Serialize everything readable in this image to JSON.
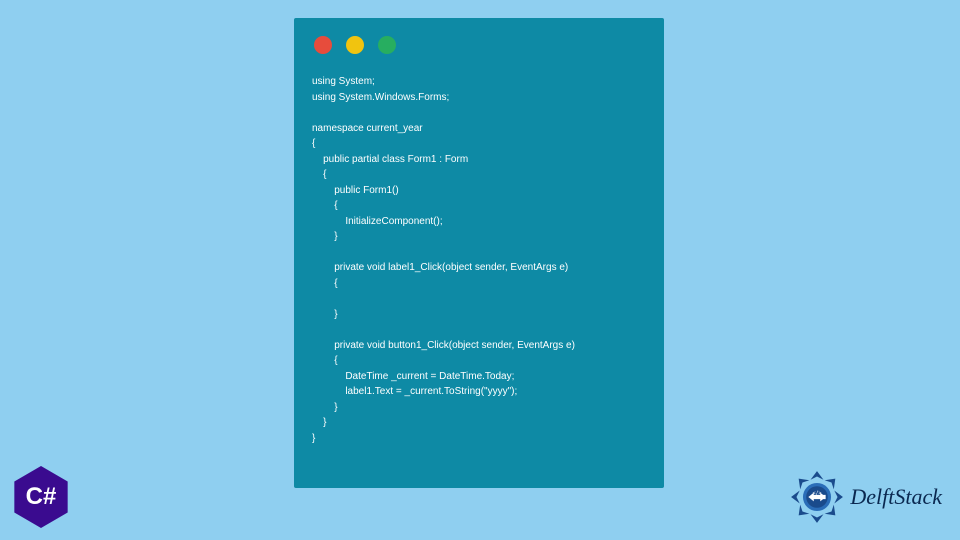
{
  "window": {
    "dots": {
      "red": "#e74c3c",
      "yellow": "#f1c40f",
      "green": "#27ae60"
    }
  },
  "code_lines": [
    "using System;",
    "using System.Windows.Forms;",
    "",
    "namespace current_year",
    "{",
    "    public partial class Form1 : Form",
    "    {",
    "        public Form1()",
    "        {",
    "            InitializeComponent();",
    "        }",
    "",
    "        private void label1_Click(object sender, EventArgs e)",
    "        {",
    "",
    "        }",
    "",
    "        private void button1_Click(object sender, EventArgs e)",
    "        {",
    "            DateTime _current = DateTime.Today;",
    "            label1.Text = _current.ToString(\"yyyy\");",
    "        }",
    "    }",
    "}"
  ],
  "badges": {
    "csharp_label": "C#",
    "delftstack_label": "DelftStack"
  }
}
